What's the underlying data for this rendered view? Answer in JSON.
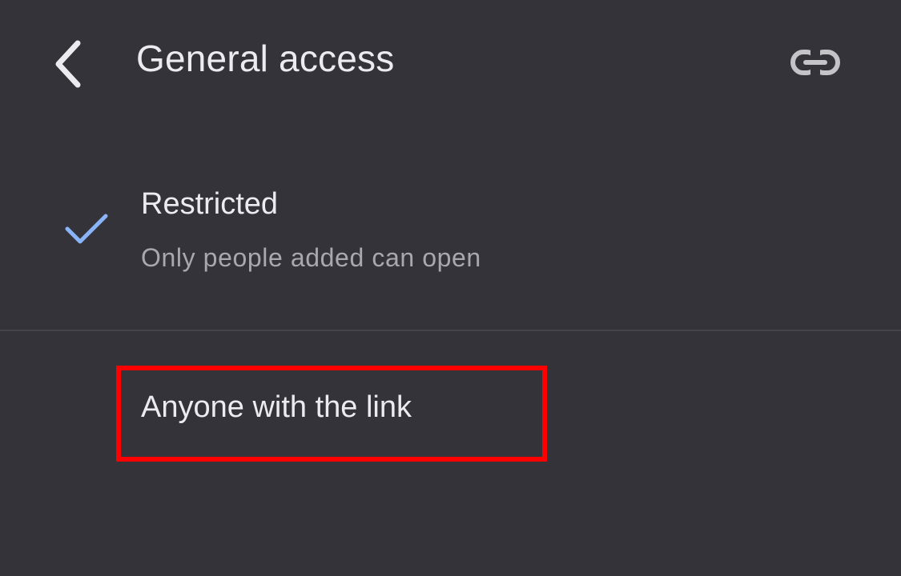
{
  "header": {
    "title": "General access"
  },
  "options": [
    {
      "label": "Restricted",
      "description": "Only people added can open",
      "selected": true
    },
    {
      "label": "Anyone with the link",
      "selected": false,
      "highlighted": true
    }
  ],
  "colors": {
    "background": "#34333a",
    "checkmark": "#8ab4f8",
    "highlight": "#ff0000",
    "text_primary": "#ececf0",
    "text_secondary": "#a9a8ae"
  },
  "icons": {
    "back": "chevron-left-icon",
    "link": "link-icon",
    "selected": "check-icon"
  }
}
